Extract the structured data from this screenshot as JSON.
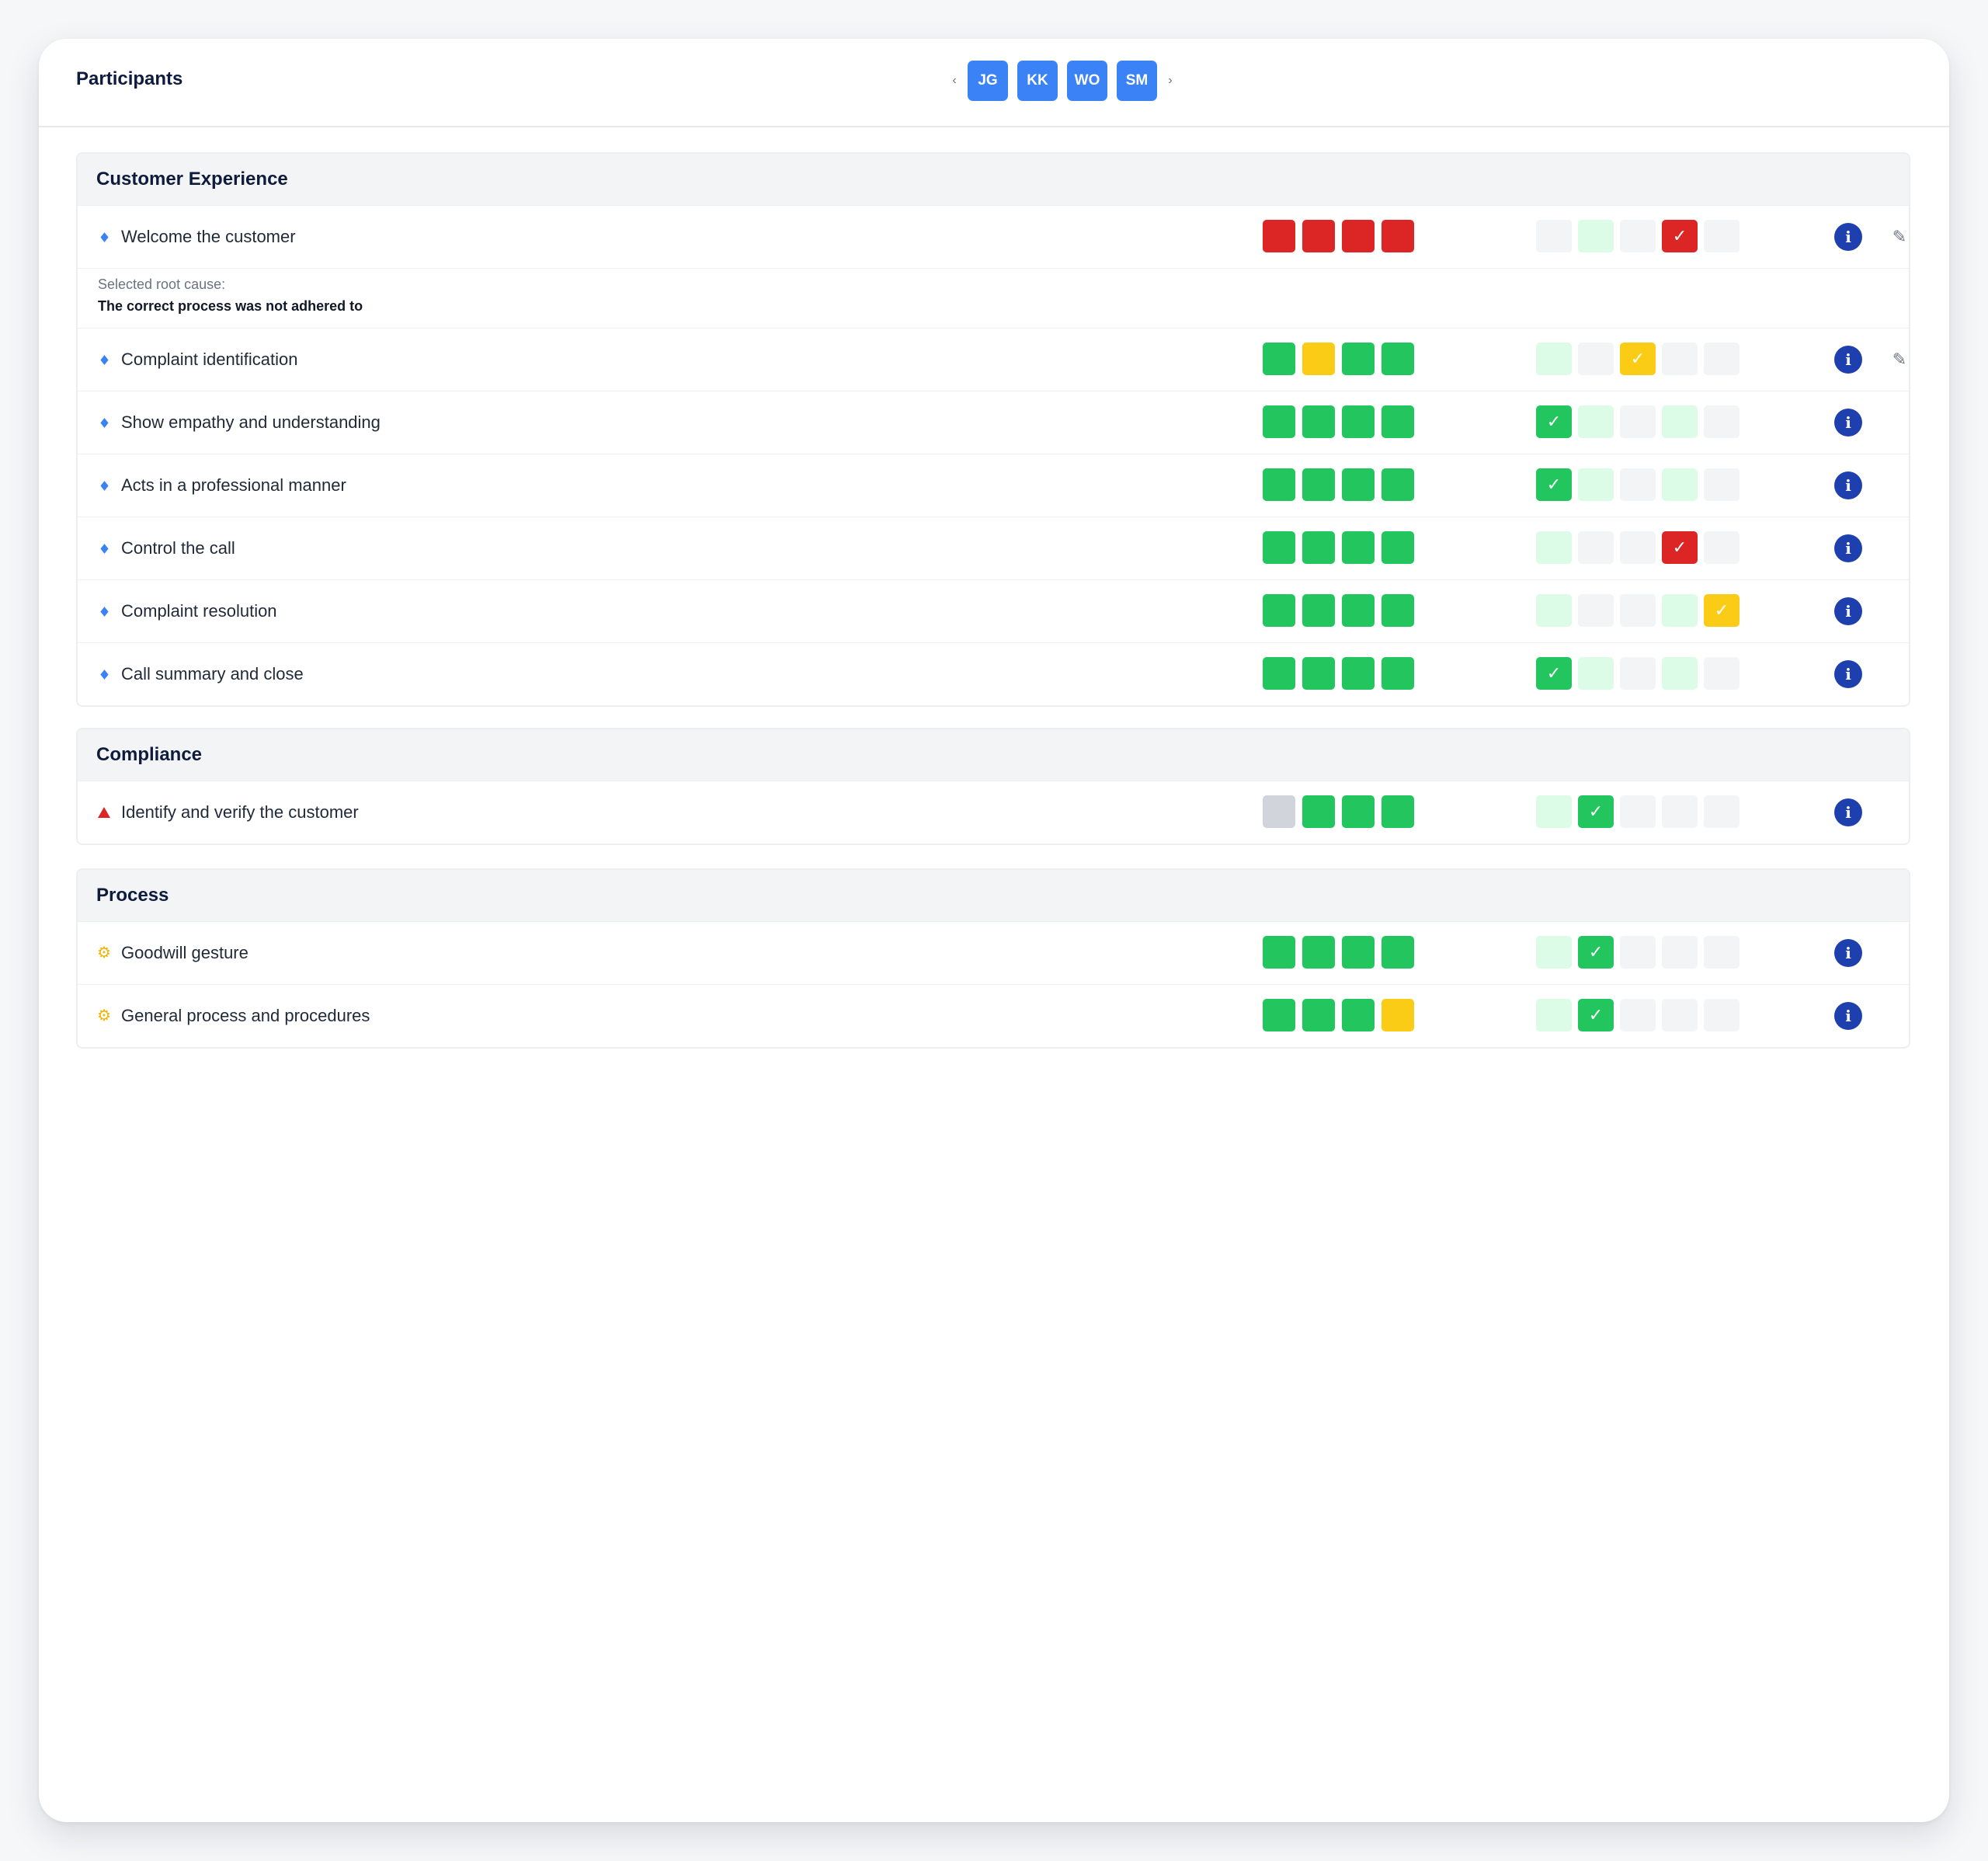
{
  "header": {
    "title": "Participants",
    "prev_icon": "‹",
    "next_icon": "›",
    "participants": [
      "JG",
      "KK",
      "WO",
      "SM"
    ]
  },
  "colors": {
    "green": "#22c55e",
    "light_green": "#dcfce7",
    "red": "#dc2626",
    "yellow": "#facc15",
    "grey": "#d1d5db",
    "light_grey": "#f3f4f6",
    "info_blue": "#1e40af",
    "avatar_blue": "#3b82f6"
  },
  "icons": {
    "check": "✓",
    "info": "i",
    "edit": "✎",
    "gear": "⚙"
  },
  "sections": [
    {
      "title": "Customer Experience",
      "rows": [
        {
          "label": "Welcome the customer",
          "marker": "diamond",
          "scores": [
            "red",
            "red",
            "red",
            "red"
          ],
          "choices": [
            "light_grey",
            "light_green",
            "light_grey",
            "red",
            "light_grey"
          ],
          "checked_index": 3,
          "editable": true,
          "root_cause": {
            "label": "Selected root cause:",
            "value": "The correct process was not adhered to"
          }
        },
        {
          "label": "Complaint identification",
          "marker": "diamond",
          "scores": [
            "green",
            "yellow",
            "green",
            "green"
          ],
          "choices": [
            "light_green",
            "light_grey",
            "yellow",
            "light_grey",
            "light_grey"
          ],
          "checked_index": 2,
          "editable": true
        },
        {
          "label": "Show empathy and understanding",
          "marker": "diamond",
          "scores": [
            "green",
            "green",
            "green",
            "green"
          ],
          "choices": [
            "green",
            "light_green",
            "light_grey",
            "light_green",
            "light_grey"
          ],
          "checked_index": 0,
          "editable": false
        },
        {
          "label": "Acts in a professional manner",
          "marker": "diamond",
          "scores": [
            "green",
            "green",
            "green",
            "green"
          ],
          "choices": [
            "green",
            "light_green",
            "light_grey",
            "light_green",
            "light_grey"
          ],
          "checked_index": 0,
          "editable": false
        },
        {
          "label": "Control the call",
          "marker": "diamond",
          "scores": [
            "green",
            "green",
            "green",
            "green"
          ],
          "choices": [
            "light_green",
            "light_grey",
            "light_grey",
            "red",
            "light_grey"
          ],
          "checked_index": 3,
          "editable": false
        },
        {
          "label": "Complaint resolution",
          "marker": "diamond",
          "scores": [
            "green",
            "green",
            "green",
            "green"
          ],
          "choices": [
            "light_green",
            "light_grey",
            "light_grey",
            "light_green",
            "yellow"
          ],
          "checked_index": 4,
          "editable": false
        },
        {
          "label": "Call summary and close",
          "marker": "diamond",
          "scores": [
            "green",
            "green",
            "green",
            "green"
          ],
          "choices": [
            "green",
            "light_green",
            "light_grey",
            "light_green",
            "light_grey"
          ],
          "checked_index": 0,
          "editable": false
        }
      ]
    },
    {
      "title": "Compliance",
      "rows": [
        {
          "label": "Identify and verify the customer",
          "marker": "triangle",
          "scores": [
            "grey",
            "green",
            "green",
            "green"
          ],
          "choices": [
            "light_green",
            "green",
            "light_grey",
            "light_grey",
            "light_grey"
          ],
          "checked_index": 1,
          "editable": false
        }
      ]
    },
    {
      "title": "Process",
      "rows": [
        {
          "label": "Goodwill gesture",
          "marker": "gear",
          "scores": [
            "green",
            "green",
            "green",
            "green"
          ],
          "choices": [
            "light_green",
            "green",
            "light_grey",
            "light_grey",
            "light_grey"
          ],
          "checked_index": 1,
          "editable": false
        },
        {
          "label": "General process and procedures",
          "marker": "gear",
          "scores": [
            "green",
            "green",
            "green",
            "yellow"
          ],
          "choices": [
            "light_green",
            "green",
            "light_grey",
            "light_grey",
            "light_grey"
          ],
          "checked_index": 1,
          "editable": false
        }
      ]
    }
  ]
}
